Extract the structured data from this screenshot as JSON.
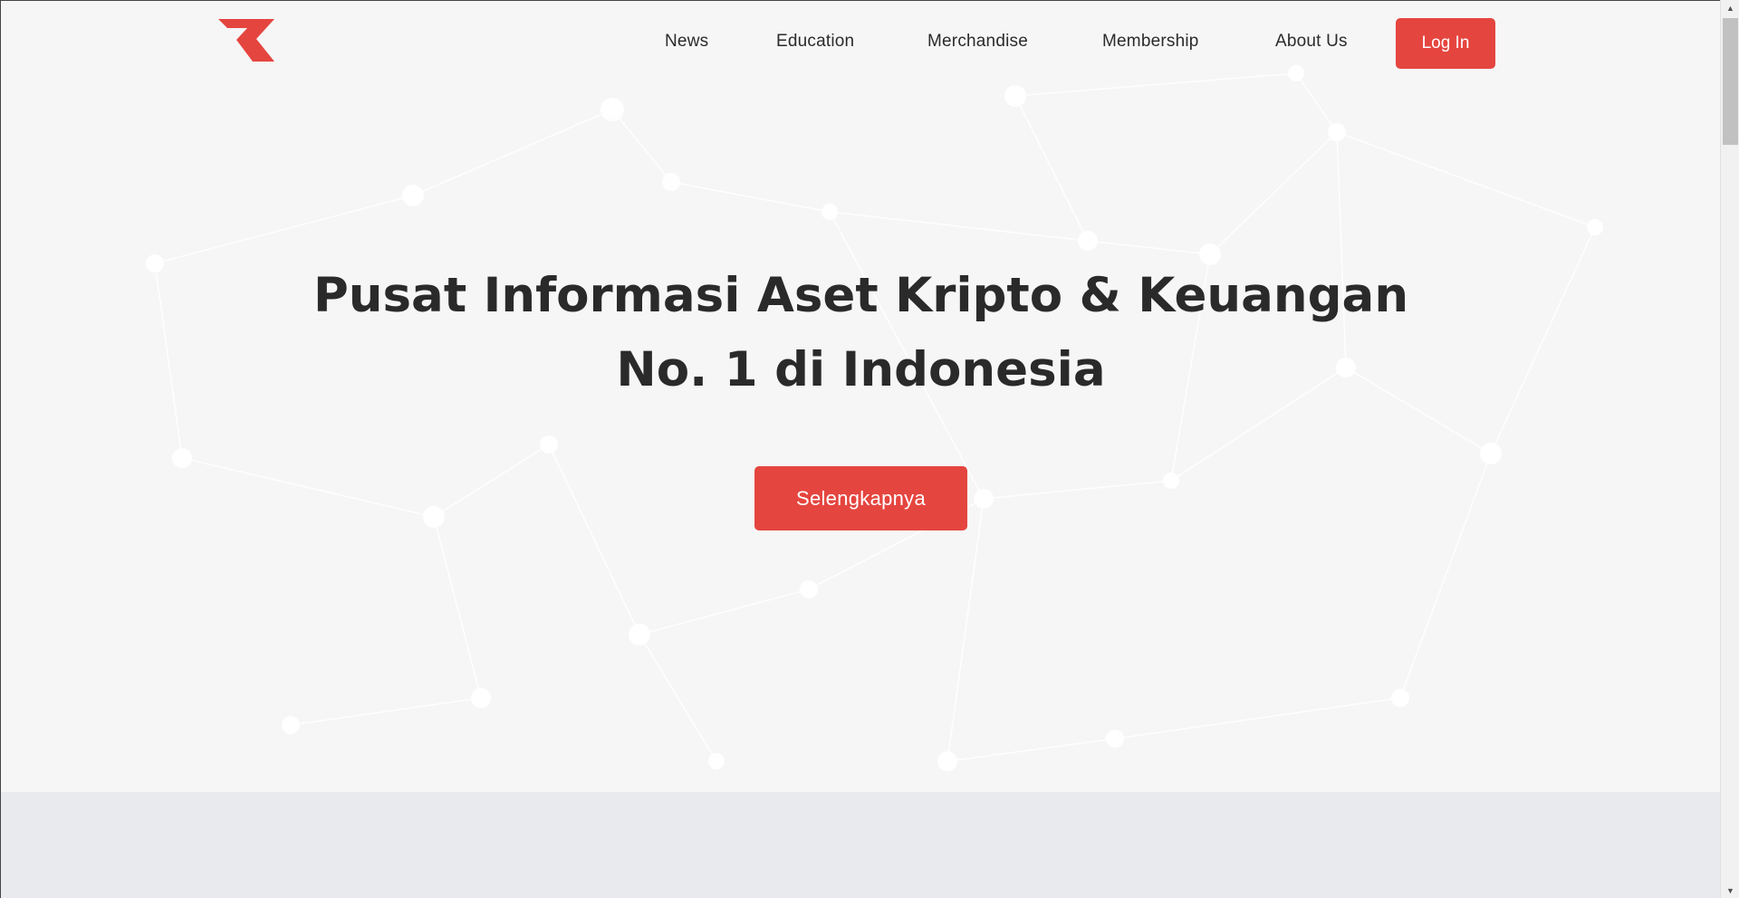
{
  "nav": {
    "logo_name": "brand-logo",
    "links": [
      {
        "label": "News"
      },
      {
        "label": "Education"
      },
      {
        "label": "Merchandise"
      },
      {
        "label": "Membership"
      },
      {
        "label": "About Us"
      }
    ],
    "login_label": "Log In"
  },
  "hero": {
    "headline_line1": "Pusat Informasi Aset Kripto & Keuangan",
    "headline_line2": "No. 1 di Indonesia",
    "cta_label": "Selengkapnya"
  },
  "colors": {
    "accent": "#e5453f",
    "hero_bg": "#f6f6f6",
    "text": "#2a2a2a",
    "section_bg": "#e9eaee"
  },
  "scrollbar": {
    "up_icon": "chevron-up-icon",
    "down_icon": "chevron-down-icon"
  }
}
